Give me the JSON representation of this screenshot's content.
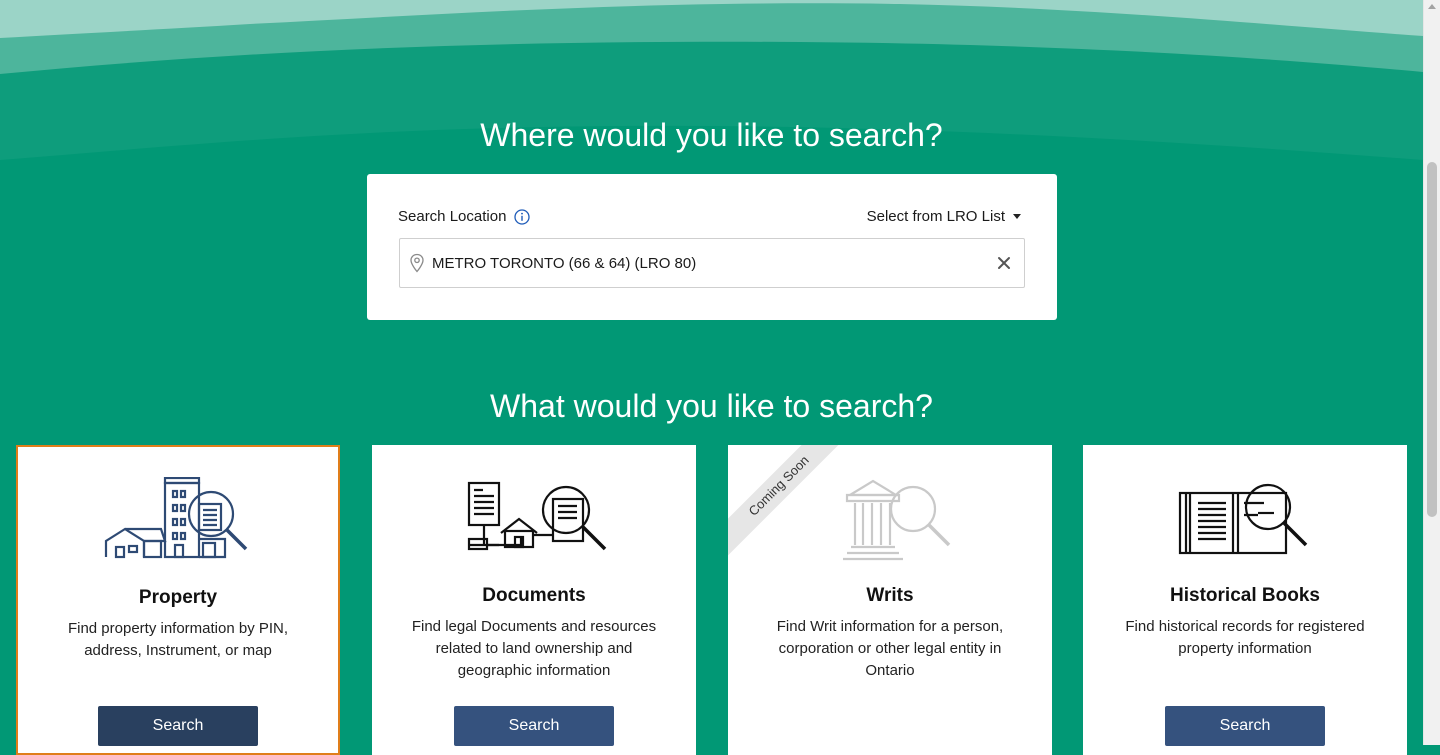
{
  "where_heading": "Where would you like to search?",
  "location": {
    "label": "Search Location",
    "lro_select": "Select from LRO List",
    "value": "METRO TORONTO (66 & 64) (LRO 80)"
  },
  "what_heading": "What would you like to search?",
  "cards": [
    {
      "title": "Property",
      "description": "Find property information by PIN, address, Instrument, or map",
      "button": "Search",
      "selected": true,
      "illustration": "building-magnifier-icon"
    },
    {
      "title": "Documents",
      "description": "Find legal Documents and resources related to land ownership and geographic information",
      "button": "Search",
      "illustration": "document-network-magnifier-icon"
    },
    {
      "title": "Writs",
      "description": "Find Writ information for a person, corporation or other legal entity in Ontario",
      "ribbon": "Coming Soon",
      "illustration": "courthouse-magnifier-icon"
    },
    {
      "title": "Historical Books",
      "description": "Find historical records for registered property information",
      "button": "Search",
      "illustration": "book-magnifier-icon"
    }
  ],
  "colors": {
    "background": "#019875",
    "card_selected_border": "#e07e1a",
    "button": "#35527e"
  }
}
